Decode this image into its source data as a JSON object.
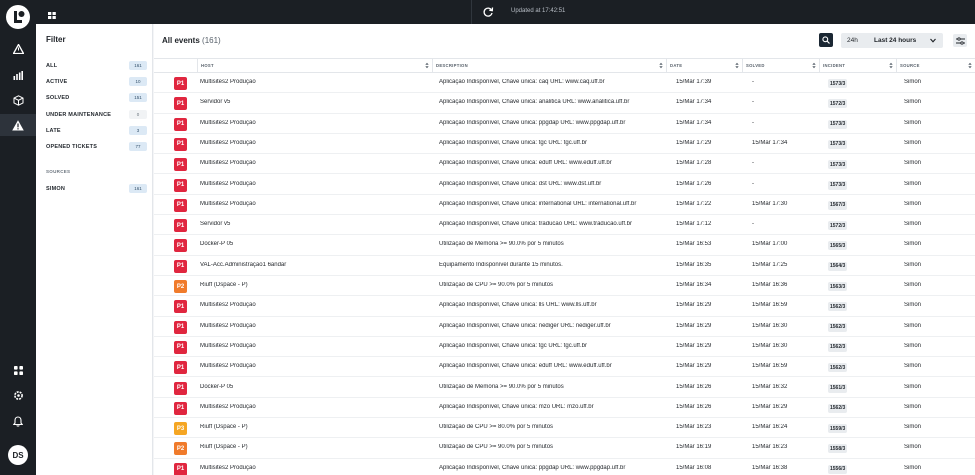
{
  "topbar": {
    "updated": "Updated at 17:42:51"
  },
  "rail": {
    "avatar_initials": "DS"
  },
  "filter": {
    "title": "Filter",
    "items": [
      {
        "label": "ALL",
        "count": "161"
      },
      {
        "label": "ACTIVE",
        "count": "10"
      },
      {
        "label": "SOLVED",
        "count": "151"
      },
      {
        "label": "UNDER MAINTENANCE",
        "count": "0"
      },
      {
        "label": "LATE",
        "count": "3"
      },
      {
        "label": "OPENED TICKETS",
        "count": "77"
      }
    ],
    "sources_heading": "SOURCES",
    "sources": [
      {
        "label": "SIMON",
        "count": "161"
      }
    ]
  },
  "main": {
    "title": "All events",
    "total": "(161)",
    "range_short": "24h",
    "range_selected": "Last 24 hours"
  },
  "table": {
    "columns": [
      "HOST",
      "DESCRIPTION",
      "DATE",
      "SOLVED",
      "INCIDENT",
      "SOURCE"
    ],
    "rows": [
      {
        "priority": "P1",
        "host": "Multisites2 Produção",
        "description": "Aplicação Indisponível, Chave única: caq URL: www.caq.uff.br",
        "date": "15/Mar 17:39",
        "solved": "-",
        "incident": "1573/3",
        "source": "Simon"
      },
      {
        "priority": "P1",
        "host": "Servidor v5",
        "description": "Aplicação Indisponível, Chave única: analitica URL: www.analitica.uff.br",
        "date": "15/Mar 17:34",
        "solved": "-",
        "incident": "1572/3",
        "source": "Simon"
      },
      {
        "priority": "P1",
        "host": "Multisites2 Produção",
        "description": "Aplicação Indisponível, Chave única: ppgdap URL: www.ppgdap.uff.br",
        "date": "15/Mar 17:34",
        "solved": "-",
        "incident": "1573/3",
        "source": "Simon"
      },
      {
        "priority": "P1",
        "host": "Multisites2 Produção",
        "description": "Aplicação Indisponível, Chave única: tgc URL: tgc.uff.br",
        "date": "15/Mar 17:29",
        "solved": "15/Mar 17:34",
        "incident": "1573/3",
        "source": "Simon"
      },
      {
        "priority": "P1",
        "host": "Multisites2 Produção",
        "description": "Aplicação Indisponível, Chave única: eduff URL: www.eduff.uff.br",
        "date": "15/Mar 17:28",
        "solved": "-",
        "incident": "1573/3",
        "source": "Simon"
      },
      {
        "priority": "P1",
        "host": "Multisites2 Produção",
        "description": "Aplicação Indisponível, Chave única: dst URL: www.dst.uff.br",
        "date": "15/Mar 17:26",
        "solved": "-",
        "incident": "1573/3",
        "source": "Simon"
      },
      {
        "priority": "P1",
        "host": "Multisites2 Produção",
        "description": "Aplicação Indisponível, Chave única: international URL: international.uff.br",
        "date": "15/Mar 17:22",
        "solved": "15/Mar 17:30",
        "incident": "1567/3",
        "source": "Simon"
      },
      {
        "priority": "P1",
        "host": "Servidor v5",
        "description": "Aplicação Indisponível, Chave única: traducao URL: www.traducao.uff.br",
        "date": "15/Mar 17:12",
        "solved": "-",
        "incident": "1572/3",
        "source": "Simon"
      },
      {
        "priority": "P1",
        "host": "Docker-P 05",
        "description": "Utilização de Memória >= 90.0% por 5 minutos",
        "date": "15/Mar 16:53",
        "solved": "15/Mar 17:00",
        "incident": "1565/3",
        "source": "Simon"
      },
      {
        "priority": "P1",
        "host": "VAL-Acc.Administração1 6andar",
        "description": "Equipamento Indisponível durante 15 minutos.",
        "date": "15/Mar 16:35",
        "solved": "15/Mar 17:25",
        "incident": "1564/3",
        "source": "Simon"
      },
      {
        "priority": "P2",
        "host": "Riuff (Dspace - P)",
        "description": "Utilização de CPU >= 90.0% por 5 minutos",
        "date": "15/Mar 16:34",
        "solved": "15/Mar 16:36",
        "incident": "1563/3",
        "source": "Simon"
      },
      {
        "priority": "P1",
        "host": "Multisites2 Produção",
        "description": "Aplicação Indisponível, Chave única: lls URL: www.lls.uff.br",
        "date": "15/Mar 16:29",
        "solved": "15/Mar 16:59",
        "incident": "1562/3",
        "source": "Simon"
      },
      {
        "priority": "P1",
        "host": "Multisites2 Produção",
        "description": "Aplicação Indisponível, Chave única: nediger URL: nediger.uff.br",
        "date": "15/Mar 16:29",
        "solved": "15/Mar 16:30",
        "incident": "1562/3",
        "source": "Simon"
      },
      {
        "priority": "P1",
        "host": "Multisites2 Produção",
        "description": "Aplicação Indisponível, Chave única: tgc URL: tgc.uff.br",
        "date": "15/Mar 16:29",
        "solved": "15/Mar 16:30",
        "incident": "1562/3",
        "source": "Simon"
      },
      {
        "priority": "P1",
        "host": "Multisites2 Produção",
        "description": "Aplicação Indisponível, Chave única: eduff URL: www.eduff.uff.br",
        "date": "15/Mar 16:29",
        "solved": "15/Mar 16:59",
        "incident": "1562/3",
        "source": "Simon"
      },
      {
        "priority": "P1",
        "host": "Docker-P 05",
        "description": "Utilização de Memória >= 90.0% por 5 minutos",
        "date": "15/Mar 16:26",
        "solved": "15/Mar 16:32",
        "incident": "1561/3",
        "source": "Simon"
      },
      {
        "priority": "P1",
        "host": "Multisites2 Produção",
        "description": "Aplicação Indisponível, Chave única: mzo URL: mzo.uff.br",
        "date": "15/Mar 16:26",
        "solved": "15/Mar 16:29",
        "incident": "1562/3",
        "source": "Simon"
      },
      {
        "priority": "P3",
        "host": "Riuff (Dspace - P)",
        "description": "Utilização de CPU >= 80.0% por 5 minutos",
        "date": "15/Mar 16:23",
        "solved": "15/Mar 16:24",
        "incident": "1559/3",
        "source": "Simon"
      },
      {
        "priority": "P2",
        "host": "Riuff (Dspace - P)",
        "description": "Utilização de CPU >= 90.0% por 5 minutos",
        "date": "15/Mar 16:19",
        "solved": "15/Mar 16:23",
        "incident": "1558/3",
        "source": "Simon"
      },
      {
        "priority": "P1",
        "host": "Multisites2 Produção",
        "description": "Aplicação Indisponível, Chave única: ppgdap URL: www.ppgdap.uff.br",
        "date": "15/Mar 16:08",
        "solved": "15/Mar 16:38",
        "incident": "1556/3",
        "source": "Simon"
      }
    ]
  },
  "colors": {
    "P1": "#e0263f",
    "P2": "#f07b2b",
    "P3": "#f5a623"
  },
  "icons": [
    "logo-icon",
    "grid-icon",
    "refresh-icon",
    "alert-icon",
    "chart-icon",
    "box-icon",
    "warning-icon",
    "apps-icon",
    "gear-icon",
    "bell-icon",
    "search-icon",
    "chevron-down-icon",
    "sliders-icon",
    "sort-icon"
  ]
}
